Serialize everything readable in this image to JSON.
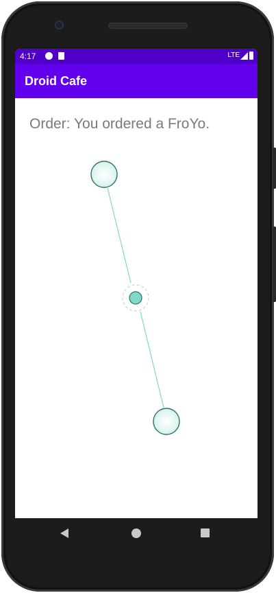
{
  "status_bar": {
    "time": "4:17",
    "network": "LTE",
    "icons": [
      "notification-icon",
      "sd-card-icon",
      "signal-icon",
      "battery-icon"
    ]
  },
  "app_bar": {
    "title": "Droid Cafe",
    "color": "#6200ee",
    "status_color": "#4f00c8"
  },
  "content": {
    "order_message": "Order: You ordered a FroYo."
  },
  "gesture_overlay": {
    "type": "drag-gesture-indicator",
    "accent": "#7fd8c8",
    "stroke": "#2f6e62"
  },
  "nav_bar": {
    "items": [
      "back-icon",
      "home-icon",
      "recents-icon"
    ]
  }
}
